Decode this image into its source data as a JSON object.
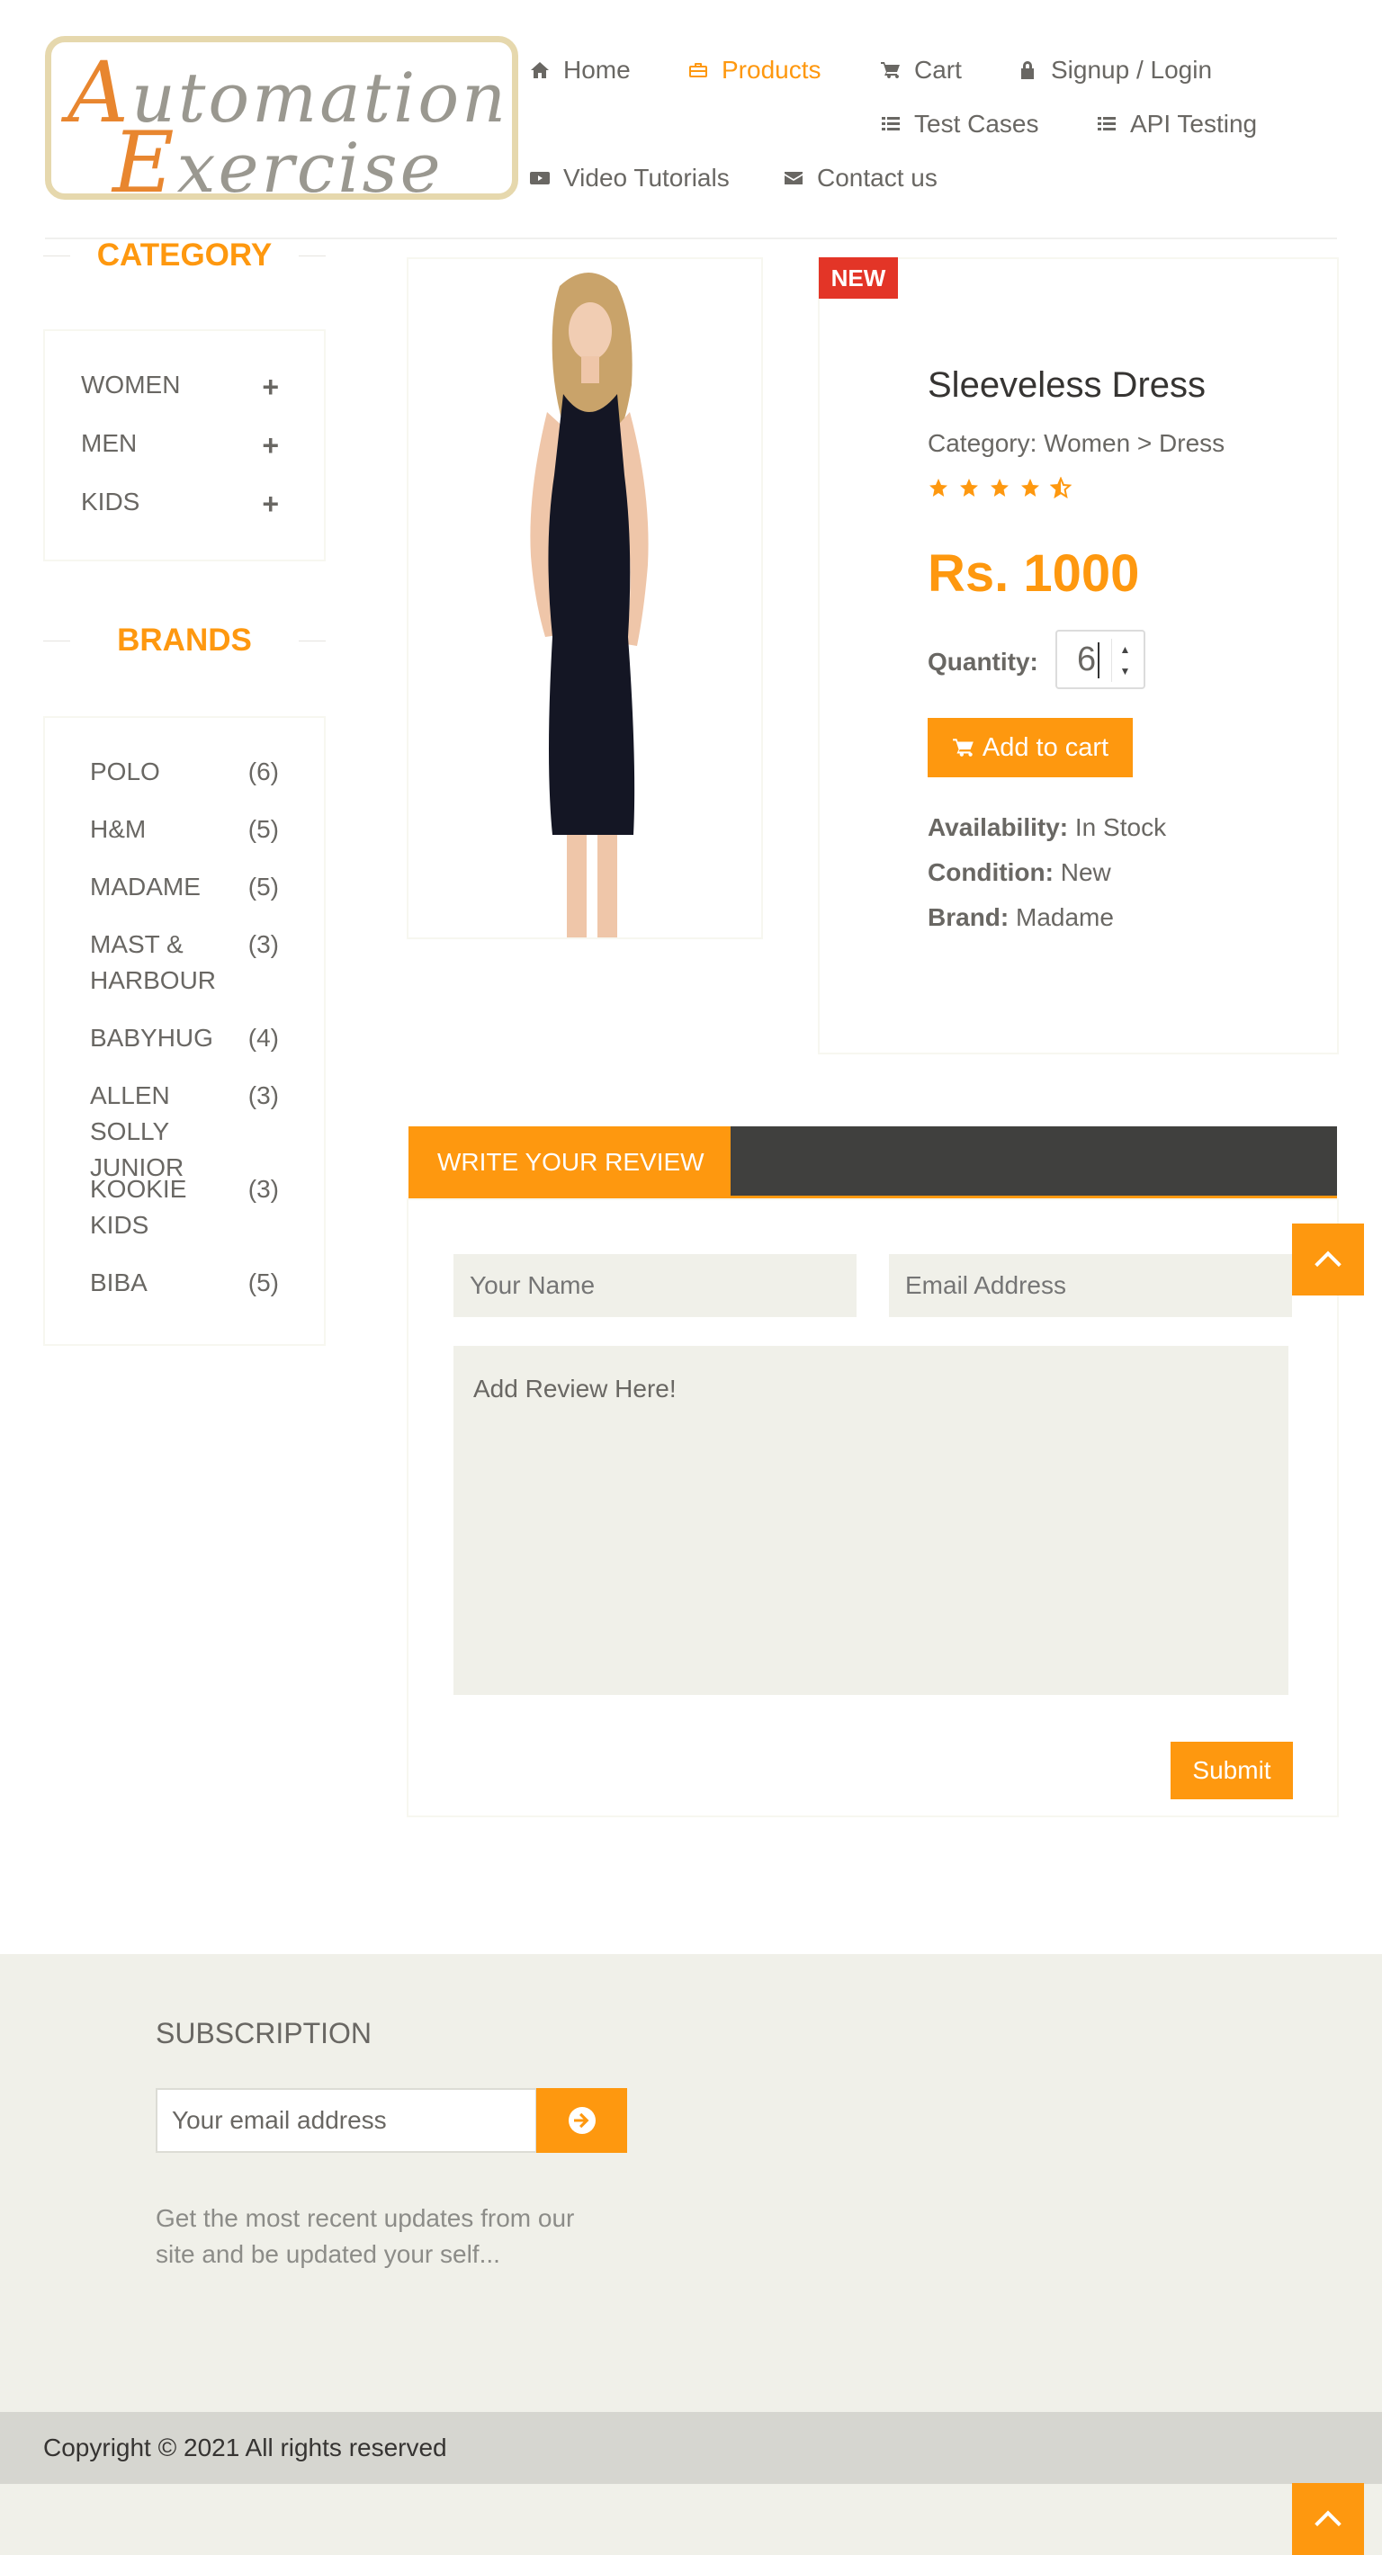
{
  "logo": {
    "line1_cap": "A",
    "line1_rest": "utomation",
    "line2_cap": "E",
    "line2_rest": "xercise"
  },
  "nav": {
    "home": "Home",
    "products": "Products",
    "cart": "Cart",
    "signup_login": "Signup / Login",
    "test_cases": "Test Cases",
    "api_testing": "API Testing",
    "video_tutorials": "Video Tutorials",
    "contact_us": "Contact us"
  },
  "sidebar": {
    "category_title": "CATEGORY",
    "categories": [
      "WOMEN",
      "MEN",
      "KIDS"
    ],
    "plus": "+",
    "brands_title": "BRANDS",
    "brands": [
      {
        "name": "POLO",
        "count": "(6)"
      },
      {
        "name": "H&M",
        "count": "(5)"
      },
      {
        "name": "MADAME",
        "count": "(5)"
      },
      {
        "name": "MAST & HARBOUR",
        "count": "(3)"
      },
      {
        "name": "BABYHUG",
        "count": "(4)"
      },
      {
        "name": "ALLEN SOLLY JUNIOR",
        "count": "(3)"
      },
      {
        "name": "KOOKIE KIDS",
        "count": "(3)"
      },
      {
        "name": "BIBA",
        "count": "(5)"
      }
    ]
  },
  "product": {
    "badge": "NEW",
    "name": "Sleeveless Dress",
    "category": "Category: Women > Dress",
    "rating": 4.5,
    "price": "Rs. 1000",
    "quantity_label": "Quantity:",
    "quantity_value": "6",
    "add_to_cart": "Add to cart",
    "availability_label": "Availability:",
    "availability_value": "In Stock",
    "condition_label": "Condition:",
    "condition_value": "New",
    "brand_label": "Brand:",
    "brand_value": "Madame"
  },
  "review": {
    "tab_label": "WRITE YOUR REVIEW",
    "name_placeholder": "Your Name",
    "email_placeholder": "Email Address",
    "review_placeholder": "Add Review Here!",
    "submit": "Submit"
  },
  "footer": {
    "subscription_title": "SUBSCRIPTION",
    "email_placeholder": "Your email address",
    "description": "Get the most recent updates from our site and be updated your self...",
    "copyright": "Copyright © 2021 All rights reserved"
  },
  "colors": {
    "accent": "#FE980F",
    "dark_bar": "#40403E",
    "badge_red": "#E33527",
    "footer_bg": "#F0F0E9"
  }
}
